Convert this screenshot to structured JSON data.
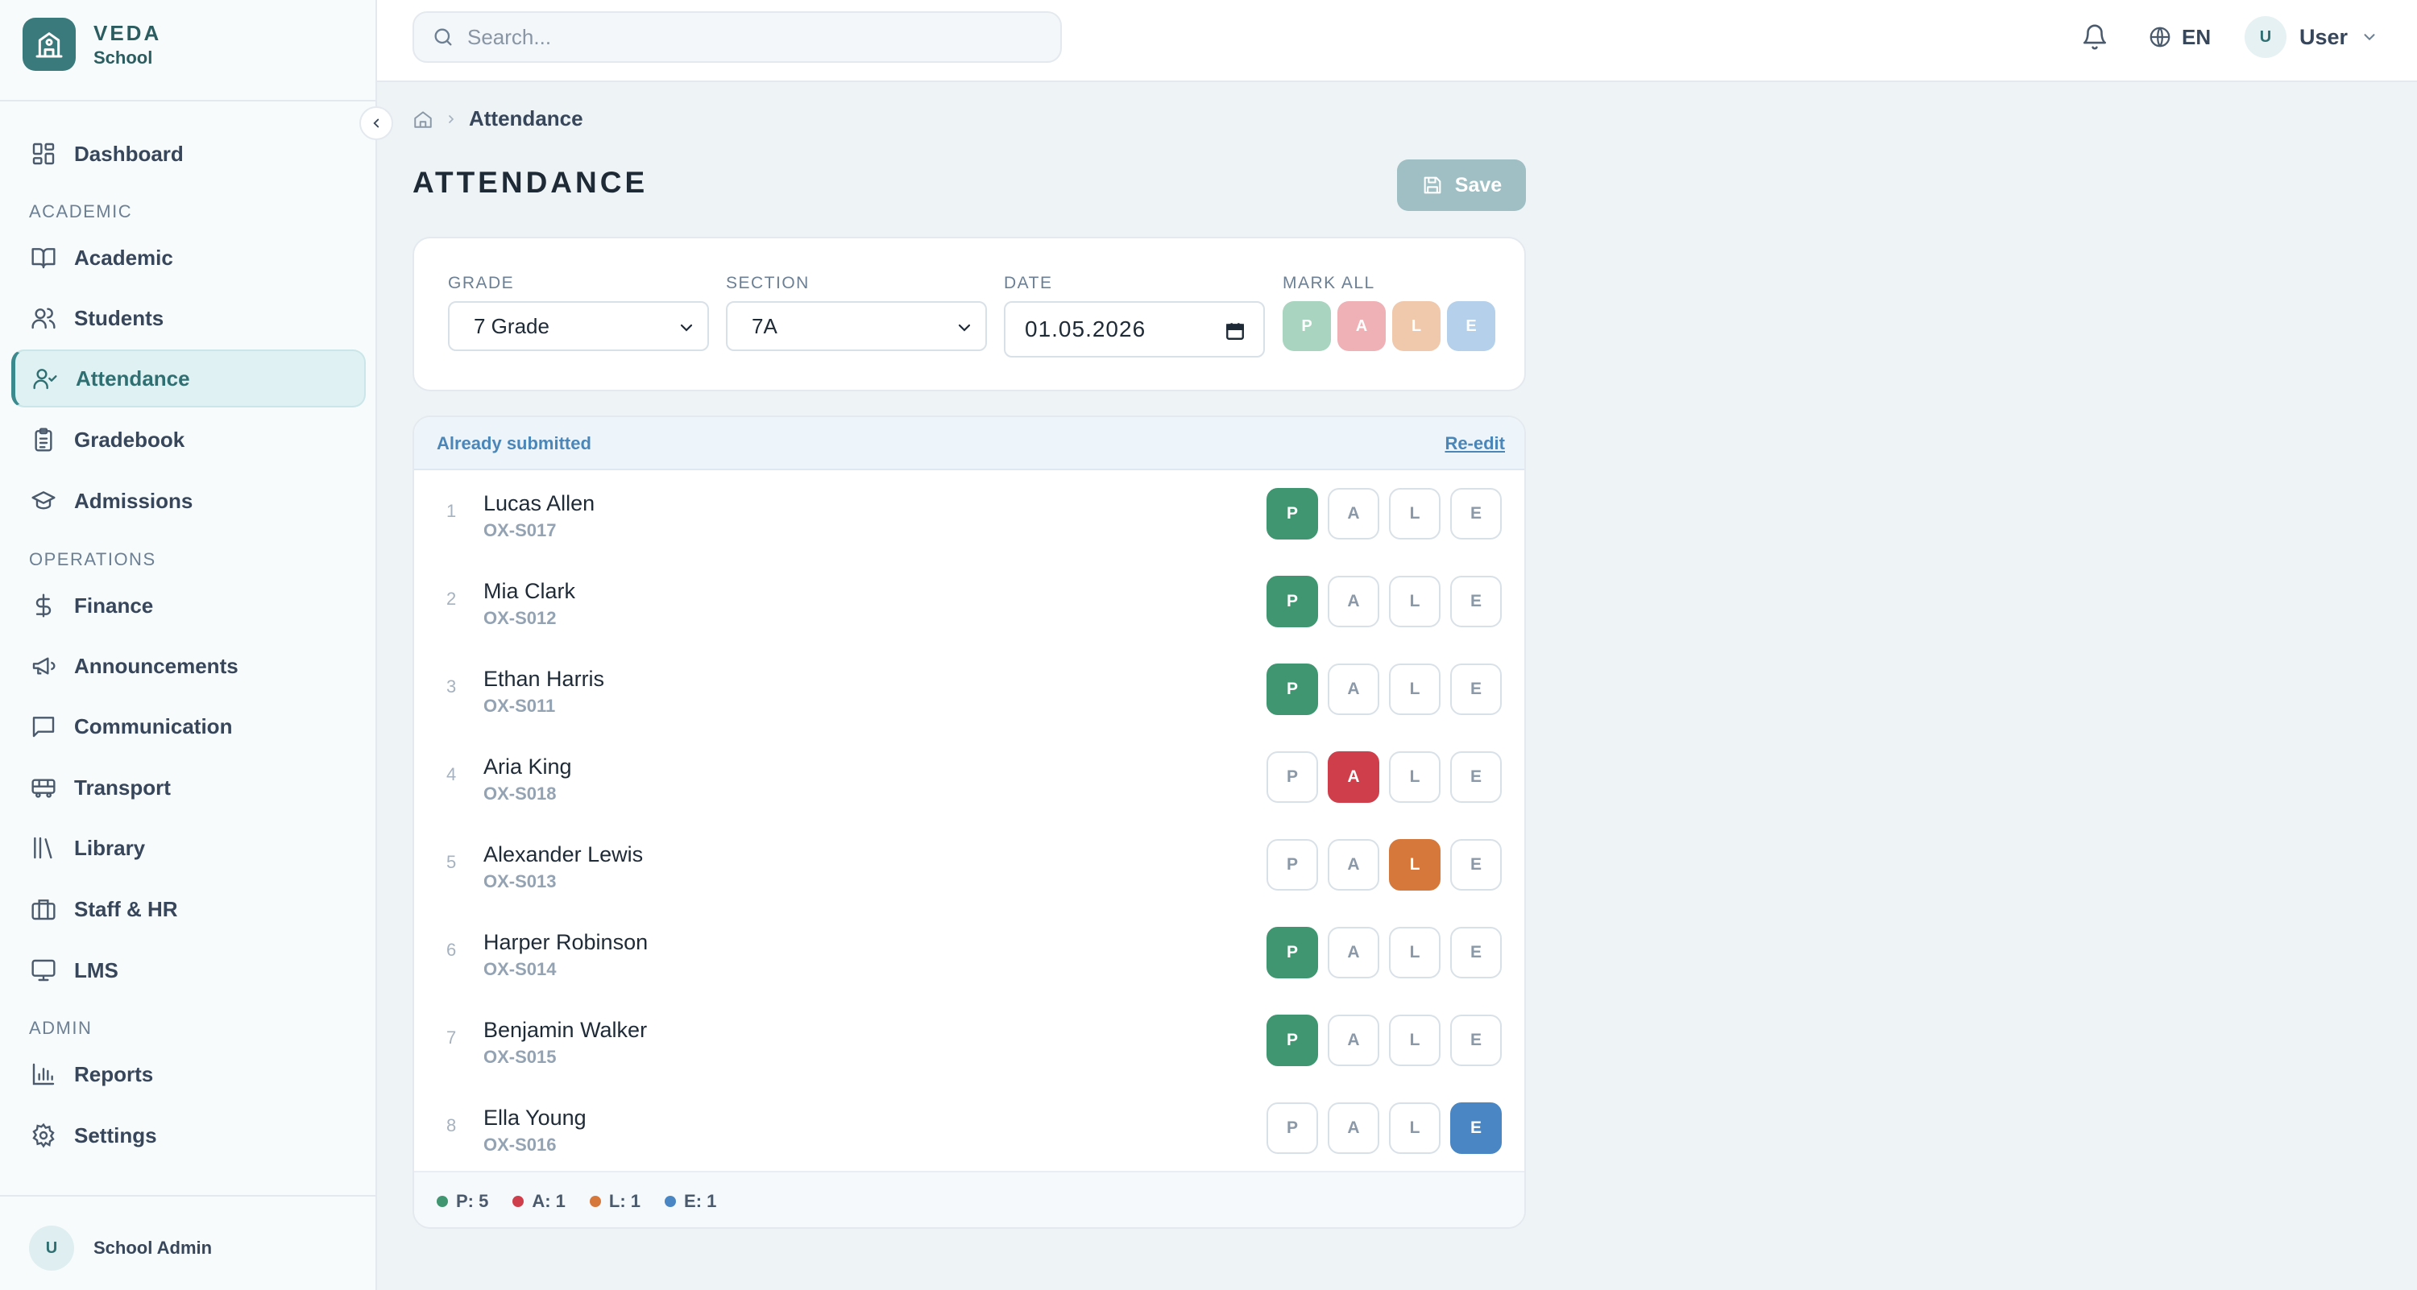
{
  "brand": {
    "name": "VEDA",
    "sub": "School"
  },
  "sidebar": {
    "items_top": [
      {
        "label": "Dashboard",
        "icon": "dashboard-icon"
      }
    ],
    "sections": [
      {
        "title": "ACADEMIC",
        "items": [
          {
            "label": "Academic",
            "icon": "book-icon"
          },
          {
            "label": "Students",
            "icon": "users-icon"
          },
          {
            "label": "Attendance",
            "icon": "user-check-icon",
            "active": true
          },
          {
            "label": "Gradebook",
            "icon": "clipboard-icon"
          },
          {
            "label": "Admissions",
            "icon": "graduation-cap-icon"
          }
        ]
      },
      {
        "title": "OPERATIONS",
        "items": [
          {
            "label": "Finance",
            "icon": "dollar-icon"
          },
          {
            "label": "Announcements",
            "icon": "megaphone-icon"
          },
          {
            "label": "Communication",
            "icon": "message-square-icon"
          },
          {
            "label": "Transport",
            "icon": "bus-icon"
          },
          {
            "label": "Library",
            "icon": "library-icon"
          },
          {
            "label": "Staff & HR",
            "icon": "briefcase-icon"
          },
          {
            "label": "LMS",
            "icon": "monitor-icon"
          }
        ]
      },
      {
        "title": "ADMIN",
        "items": [
          {
            "label": "Reports",
            "icon": "bar-chart-icon"
          },
          {
            "label": "Settings",
            "icon": "gear-icon"
          }
        ]
      }
    ],
    "footer": {
      "avatar_initial": "U",
      "name": "School Admin"
    }
  },
  "header": {
    "search_placeholder": "Search...",
    "language": "EN",
    "user_initial": "U",
    "user_name": "User"
  },
  "breadcrumb": {
    "current": "Attendance"
  },
  "page": {
    "title": "ATTENDANCE",
    "save_label": "Save"
  },
  "filters": {
    "grade": {
      "label": "GRADE",
      "value": "7 Grade"
    },
    "section": {
      "label": "SECTION",
      "value": "7A"
    },
    "date": {
      "label": "DATE",
      "value": "01.05.2026"
    },
    "mark_all": {
      "label": "MARK ALL",
      "options": [
        "P",
        "A",
        "L",
        "E"
      ]
    }
  },
  "status_options": [
    "P",
    "A",
    "L",
    "E"
  ],
  "list": {
    "status_text": "Already submitted",
    "reedit_label": "Re-edit",
    "students": [
      {
        "num": "1",
        "name": "Lucas Allen",
        "id": "OX-S017",
        "status": "P"
      },
      {
        "num": "2",
        "name": "Mia Clark",
        "id": "OX-S012",
        "status": "P"
      },
      {
        "num": "3",
        "name": "Ethan Harris",
        "id": "OX-S011",
        "status": "P"
      },
      {
        "num": "4",
        "name": "Aria King",
        "id": "OX-S018",
        "status": "A"
      },
      {
        "num": "5",
        "name": "Alexander Lewis",
        "id": "OX-S013",
        "status": "L"
      },
      {
        "num": "6",
        "name": "Harper Robinson",
        "id": "OX-S014",
        "status": "P"
      },
      {
        "num": "7",
        "name": "Benjamin Walker",
        "id": "OX-S015",
        "status": "P"
      },
      {
        "num": "8",
        "name": "Ella Young",
        "id": "OX-S016",
        "status": "E"
      }
    ],
    "summary": [
      {
        "text": "P: 5",
        "color": "#3f9670"
      },
      {
        "text": "A: 1",
        "color": "#cf3f4b"
      },
      {
        "text": "L: 1",
        "color": "#d6783b"
      },
      {
        "text": "E: 1",
        "color": "#4a86c4"
      }
    ]
  },
  "colors": {
    "accent": "#3a7a7c",
    "present": "#3f9670",
    "absent": "#cf3f4b",
    "late": "#d6783b",
    "excused": "#4a86c4",
    "mark_all_p": "#a9d4bf",
    "mark_all_a": "#efb1b6",
    "mark_all_l": "#f0c9ac",
    "mark_all_e": "#b4d0ea"
  }
}
